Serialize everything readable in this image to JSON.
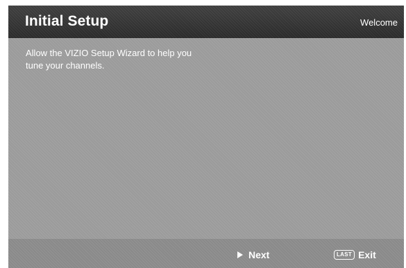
{
  "header": {
    "title": "Initial Setup",
    "breadcrumb": "Welcome"
  },
  "content": {
    "message": "Allow the VIZIO Setup Wizard to help you tune your channels."
  },
  "footer": {
    "next_label": "Next",
    "next_icon": "play-icon",
    "last_key_label": "LAST",
    "exit_label": "Exit"
  },
  "colors": {
    "header_bg": "#333333",
    "content_bg": "#9b9b9b",
    "footer_bg": "#8a8a8a",
    "text": "#ffffff"
  }
}
